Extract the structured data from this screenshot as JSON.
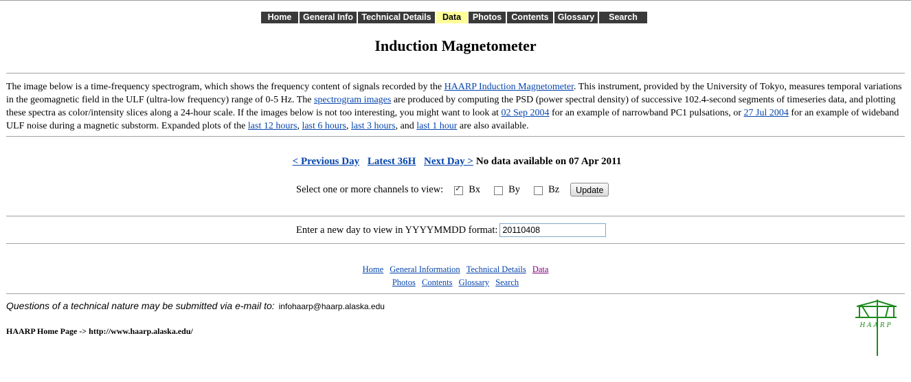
{
  "nav": {
    "items": [
      "Home",
      "General Info",
      "Technical Details",
      "Data",
      "Photos",
      "Contents",
      "Glossary",
      "Search"
    ],
    "active": "Data"
  },
  "title": "Induction Magnetometer",
  "intro": {
    "t1": "The image below is a time-frequency spectrogram, which shows the frequency content of signals recorded by the ",
    "l1": "HAARP Induction Magnetometer",
    "t2": ". This instrument, provided by the University of Tokyo, measures temporal variations in the geomagnetic field in the ULF (ultra-low frequency) range of 0-5 Hz. The ",
    "l2": "spectrogram images",
    "t3": " are produced by computing the PSD (power spectral density) of successive 102.4-second segments of timeseries data, and plotting these spectra as color/intensity slices along a 24-hour scale. If the images below is not too interesting, you might want to look at ",
    "l3": "02 Sep 2004",
    "t4": " for an example of narrowband PC1 pulsations, or ",
    "l4": "27 Jul 2004",
    "t5": " for an example of wideband ULF noise during a magnetic substorm. Expanded plots of the ",
    "l5": "last 12 hours",
    "t6": ", ",
    "l6": "last 6 hours",
    "t7": ", ",
    "l7": "last 3 hours",
    "t8": ", and ",
    "l8": "last 1 hour",
    "t9": " are also available."
  },
  "daynav": {
    "prev": "< Previous Day",
    "latest": "Latest 36H",
    "next": "Next Day >",
    "status": "No data available on 07 Apr 2011"
  },
  "channels": {
    "label": "Select one or more channels to view:",
    "options": [
      {
        "label": "Bx",
        "checked": true
      },
      {
        "label": "By",
        "checked": false
      },
      {
        "label": "Bz",
        "checked": false
      }
    ],
    "button": "Update"
  },
  "date_entry": {
    "label": "Enter a new day to view in YYYYMMDD format:",
    "value": "20110408"
  },
  "footer_nav": {
    "row1": [
      "Home",
      "General Information",
      "Technical Details",
      "Data"
    ],
    "row2": [
      "Photos",
      "Contents",
      "Glossary",
      "Search"
    ]
  },
  "contact": {
    "text": "Questions of a technical nature may be submitted via e-mail to:",
    "email": "infohaarp@haarp.alaska.edu"
  },
  "homepage": "HAARP Home Page -> http://www.haarp.alaska.edu/",
  "logo": {
    "text": "H A A R P",
    "color": "#1a8a1a"
  }
}
